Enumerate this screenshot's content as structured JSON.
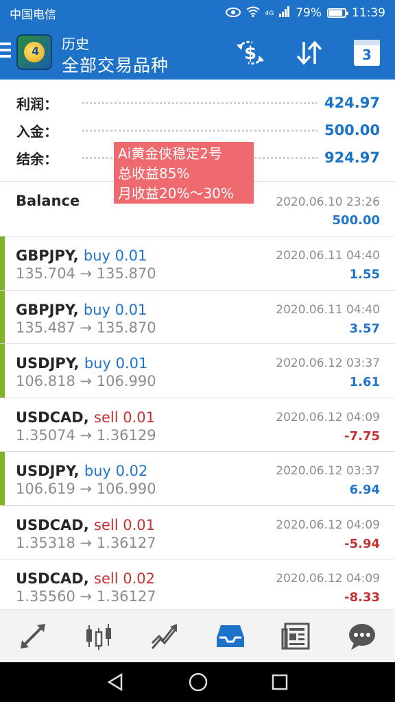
{
  "statusbar": {
    "carrier": "中国电信",
    "network": "4G",
    "battery": "79%",
    "battery_level": 0.79,
    "time": "11:39"
  },
  "appbar": {
    "title": "历史",
    "subtitle": "全部交易品种",
    "calendar_day": "3"
  },
  "summary": [
    {
      "label": "利润：",
      "value": "424.97"
    },
    {
      "label": "入金：",
      "value": "500.00"
    },
    {
      "label": "结余：",
      "value": "924.97"
    }
  ],
  "overlay": {
    "line1": "Ai黄金侠稳定2号",
    "line2": "总收益85%",
    "line3": "月收益20%～30%"
  },
  "balance_row": {
    "title": "Balance",
    "date": "2020.06.10 23:26",
    "amount": "500.00"
  },
  "deals": [
    {
      "symbol": "GBPJPY,",
      "direction": "buy 0.01",
      "prices": "135.704 → 135.870",
      "date": "2020.06.11 04:40",
      "profit": "1.55"
    },
    {
      "symbol": "GBPJPY,",
      "direction": "buy 0.01",
      "prices": "135.487 → 135.870",
      "date": "2020.06.11 04:40",
      "profit": "3.57"
    },
    {
      "symbol": "USDJPY,",
      "direction": "buy 0.01",
      "prices": "106.818 → 106.990",
      "date": "2020.06.12 03:37",
      "profit": "1.61"
    },
    {
      "symbol": "USDCAD,",
      "direction": "sell 0.01",
      "prices": "1.35074 → 1.36129",
      "date": "2020.06.12 04:09",
      "profit": "-7.75"
    },
    {
      "symbol": "USDJPY,",
      "direction": "buy 0.02",
      "prices": "106.619 → 106.990",
      "date": "2020.06.12 03:37",
      "profit": "6.94"
    },
    {
      "symbol": "USDCAD,",
      "direction": "sell 0.01",
      "prices": "1.35318 → 1.36127",
      "date": "2020.06.12 04:09",
      "profit": "-5.94"
    },
    {
      "symbol": "USDCAD,",
      "direction": "sell 0.02",
      "prices": "1.35560 → 1.36127",
      "date": "2020.06.12 04:09",
      "profit": "-8.33"
    }
  ],
  "colors": {
    "accent": "#1e73c9",
    "buy": "#1f74c9",
    "sell": "#c53030",
    "win_bar": "#82b22a"
  },
  "bottom_nav": [
    {
      "icon": "quotes-arrows-icon"
    },
    {
      "icon": "candlestick-chart-icon"
    },
    {
      "icon": "trend-chart-icon"
    },
    {
      "icon": "history-inbox-icon",
      "active": true
    },
    {
      "icon": "news-icon"
    },
    {
      "icon": "chat-icon"
    }
  ]
}
